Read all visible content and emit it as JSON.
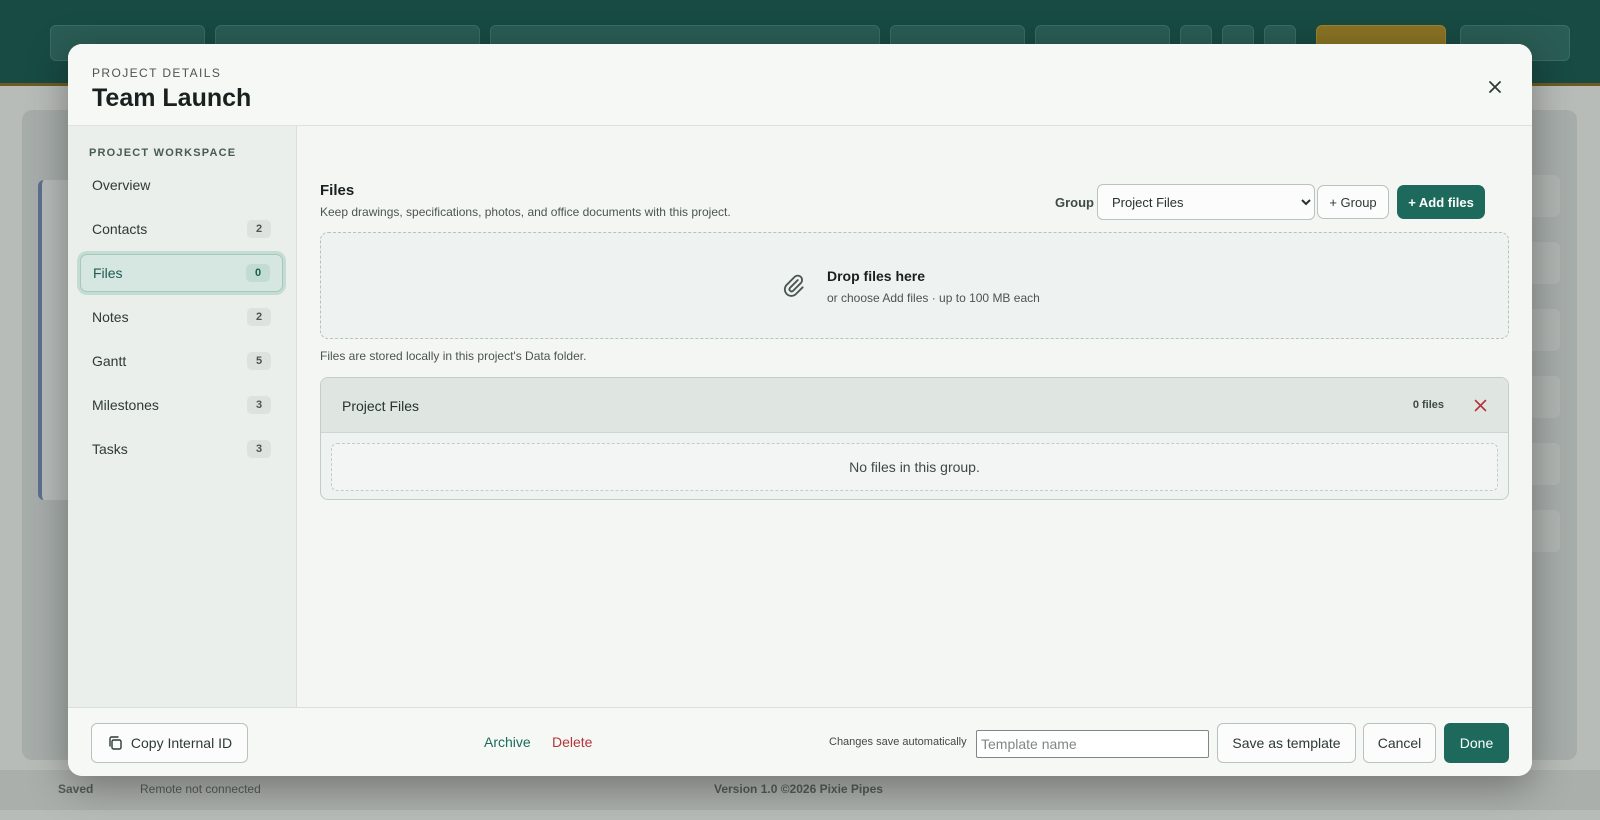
{
  "colors": {
    "accent": "#1d6a5c",
    "danger": "#b3343a",
    "active_nav_bg": "#d6e6e0",
    "topbar": "#184b43"
  },
  "background": {
    "footer_status": "Saved",
    "footer_remote": "Remote not connected",
    "footer_version": "Version 1.0 ©2026 Pixie Pipes"
  },
  "modal": {
    "eyebrow": "PROJECT DETAILS",
    "title": "Team Launch",
    "close_icon": "close-icon"
  },
  "sidebar": {
    "heading": "PROJECT WORKSPACE",
    "items": [
      {
        "label": "Overview",
        "count": ""
      },
      {
        "label": "Contacts",
        "count": "2"
      },
      {
        "label": "Files",
        "count": "0",
        "active": true
      },
      {
        "label": "Notes",
        "count": "2"
      },
      {
        "label": "Gantt",
        "count": "5"
      },
      {
        "label": "Milestones",
        "count": "3"
      },
      {
        "label": "Tasks",
        "count": "3"
      }
    ]
  },
  "files": {
    "title": "Files",
    "description": "Keep drawings, specifications, photos, and office documents with this project.",
    "group_label": "Group",
    "group_selected": "Project Files",
    "add_group_label": "+ Group",
    "add_files_label": "+ Add files",
    "dropzone_icon": "paperclip-icon",
    "dropzone_title": "Drop files here",
    "dropzone_sub": "or choose Add files · up to 100 MB each",
    "storage_note": "Files are stored locally in this project's Data folder.",
    "groups": [
      {
        "name": "Project Files",
        "count": "0 files",
        "empty": "No files in this group."
      }
    ]
  },
  "footer": {
    "copy_id_label": "Copy Internal ID",
    "copy_icon": "copy-icon",
    "archive_label": "Archive",
    "delete_label": "Delete",
    "autosave_note": "Changes save automatically",
    "template_placeholder": "Template name",
    "save_template_label": "Save as template",
    "cancel_label": "Cancel",
    "done_label": "Done"
  }
}
